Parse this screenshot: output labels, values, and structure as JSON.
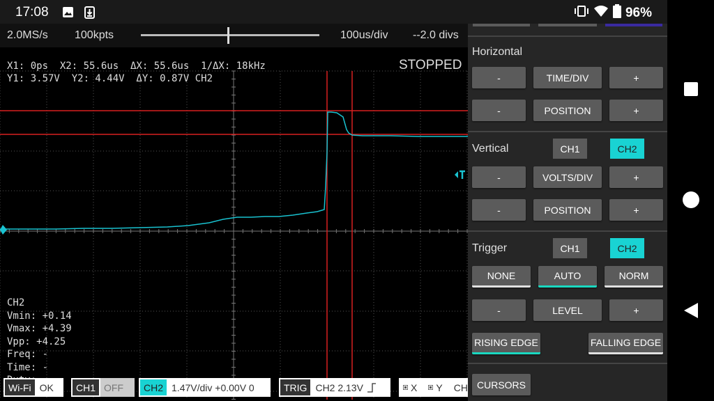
{
  "status_bar": {
    "time": "17:08",
    "battery": "96%"
  },
  "scope": {
    "sample_rate": "2.0MS/s",
    "points": "100kpts",
    "timebase": "100us/div",
    "position": "--2.0 divs",
    "cursor_line1": "X1: 0ps  X2: 55.6us  ΔX: 55.6us  1/ΔX: 18kHz",
    "cursor_line2": "Y1: 3.57V  Y2: 4.44V  ΔY: 0.87V CH2",
    "state": "STOPPED",
    "measure": {
      "channel": "CH2",
      "vmin": "Vmin: +0.14",
      "vmax": "Vmax: +4.39",
      "vpp": "Vpp: +4.25",
      "freq": "Freq: -",
      "time": "Time: -",
      "duty": "Duty: -"
    },
    "colors": {
      "trace": "#19c2d0",
      "cursor": "#d82020",
      "grid": "#555555"
    }
  },
  "bottom": {
    "wifi_tag": "Wi-Fi",
    "wifi_val": "OK",
    "ch1_tag": "CH1",
    "ch1_val": "OFF",
    "ch2_tag": "CH2",
    "ch2_val": "1.47V/div  +0.00V 0",
    "trig_tag": "TRIG",
    "trig_val": "CH2   2.13V",
    "xy_x": "X",
    "xy_y": "Y",
    "xy_ch": "CH"
  },
  "panel": {
    "horizontal": {
      "title": "Horizontal",
      "minus": "-",
      "plus": "+",
      "time_div": "TIME/DIV",
      "position": "POSITION"
    },
    "vertical": {
      "title": "Vertical",
      "ch1": "CH1",
      "ch2": "CH2",
      "minus": "-",
      "plus": "+",
      "volts_div": "VOLTS/DIV",
      "position": "POSITION"
    },
    "trigger": {
      "title": "Trigger",
      "ch1": "CH1",
      "ch2": "CH2",
      "none": "NONE",
      "auto": "AUTO",
      "norm": "NORM",
      "minus": "-",
      "plus": "+",
      "level": "LEVEL",
      "rising": "RISING EDGE",
      "falling": "FALLING EDGE"
    },
    "cursors": "CURSORS"
  }
}
